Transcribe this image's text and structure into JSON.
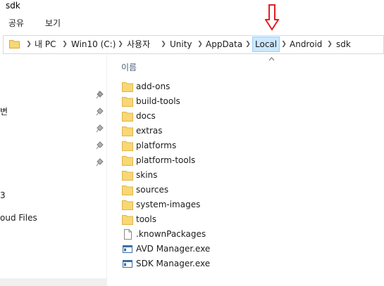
{
  "window": {
    "title": "sdk"
  },
  "ribbon": {
    "tabs": [
      "공유",
      "보기"
    ]
  },
  "address": {
    "segments": [
      "내 PC",
      "Win10 (C:)",
      "사용자",
      "Unity",
      "AppData",
      "Local",
      "Android",
      "sdk"
    ],
    "highlighted": "Local"
  },
  "sidebar": {
    "items": [
      "변",
      "",
      "",
      "",
      "",
      "",
      "3",
      "oud Files"
    ]
  },
  "main": {
    "column_header": "이름",
    "files": [
      {
        "name": "add-ons",
        "icon": "folder-icon"
      },
      {
        "name": "build-tools",
        "icon": "folder-icon"
      },
      {
        "name": "docs",
        "icon": "folder-icon"
      },
      {
        "name": "extras",
        "icon": "folder-icon"
      },
      {
        "name": "platforms",
        "icon": "folder-icon"
      },
      {
        "name": "platform-tools",
        "icon": "folder-icon"
      },
      {
        "name": "skins",
        "icon": "folder-icon"
      },
      {
        "name": "sources",
        "icon": "folder-icon"
      },
      {
        "name": "system-images",
        "icon": "folder-icon"
      },
      {
        "name": "tools",
        "icon": "folder-icon"
      },
      {
        "name": ".knownPackages",
        "icon": "file-icon"
      },
      {
        "name": "AVD Manager.exe",
        "icon": "exe-icon"
      },
      {
        "name": "SDK Manager.exe",
        "icon": "exe-icon"
      }
    ]
  },
  "colors": {
    "folder": "#f8d775",
    "highlight": "#cce8ff",
    "annotation_arrow": "#e02020"
  }
}
